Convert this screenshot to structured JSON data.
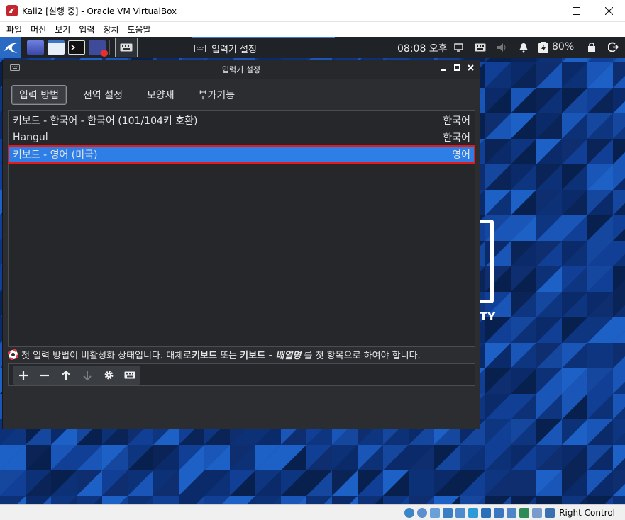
{
  "vbox": {
    "title": "Kali2 [실행 중] - Oracle VM VirtualBox",
    "menu": [
      "파일",
      "머신",
      "보기",
      "입력",
      "장치",
      "도움말"
    ],
    "host_key": "Right Control"
  },
  "panel": {
    "window_button_label": "입력기 설정",
    "clock": "08:08 오후",
    "battery": "80%"
  },
  "dialog": {
    "title": "입력기 설정",
    "tabs": [
      "입력 방법",
      "전역 설정",
      "모양새",
      "부가기능"
    ],
    "active_tab": "입력 방법",
    "items": [
      {
        "name": "키보드 - 한국어 - 한국어 (101/104키 호환)",
        "lang": "한국어"
      },
      {
        "name": "Hangul",
        "lang": "한국어"
      },
      {
        "name": "키보드 - 영어 (미국)",
        "lang": "영어"
      }
    ],
    "selected_index": 2,
    "status": {
      "part1": "첫 입력 방법이 비활성화 상태입니다. 대체로 ",
      "bold1": "키보드",
      "part2": " 또는 ",
      "bold2": "키보드 - ",
      "italic": "배열명",
      "part3": " 를 첫 항목으로 하여야 합니다."
    },
    "toolbar_icons": [
      "add-icon",
      "remove-icon",
      "move-up-icon",
      "move-down-icon",
      "settings-icon",
      "keyboard-icon"
    ]
  },
  "colors": {
    "selection": "#2d7ee6",
    "highlight_border": "#e11b1b",
    "desktop_base": "#0b2a66"
  }
}
